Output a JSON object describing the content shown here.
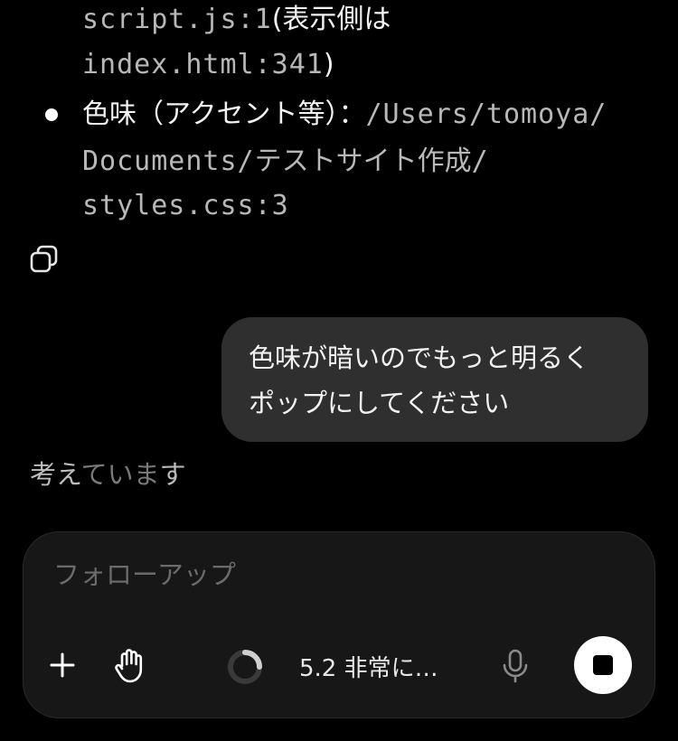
{
  "code_ref": {
    "line1_code": "script.js:1",
    "line1_text": "(表示側は",
    "line2_code": "index.html:341",
    "line2_text": ")"
  },
  "bullet": {
    "label": "色味（アクセント等）：",
    "path1": "/Users/tomoya/",
    "path2_code": "Documents/",
    "path2_text": "テストサイト作成",
    "path2_slash": "/",
    "path3": "styles.css:3"
  },
  "user_message": {
    "line1": "色味が暗いのでもっと明るく",
    "line2": "ポップにしてください"
  },
  "status": {
    "thinking_a": "考え",
    "thinking_b": "ていま",
    "thinking_c": "す"
  },
  "composer": {
    "placeholder": "フォローアップ",
    "model_label": "5.2  非常に…"
  },
  "icons": {
    "copy": "copy-icon",
    "add": "plus-icon",
    "hand": "hand-icon",
    "spinner": "loading-spinner-icon",
    "mic": "microphone-icon",
    "stop": "stop-icon"
  }
}
